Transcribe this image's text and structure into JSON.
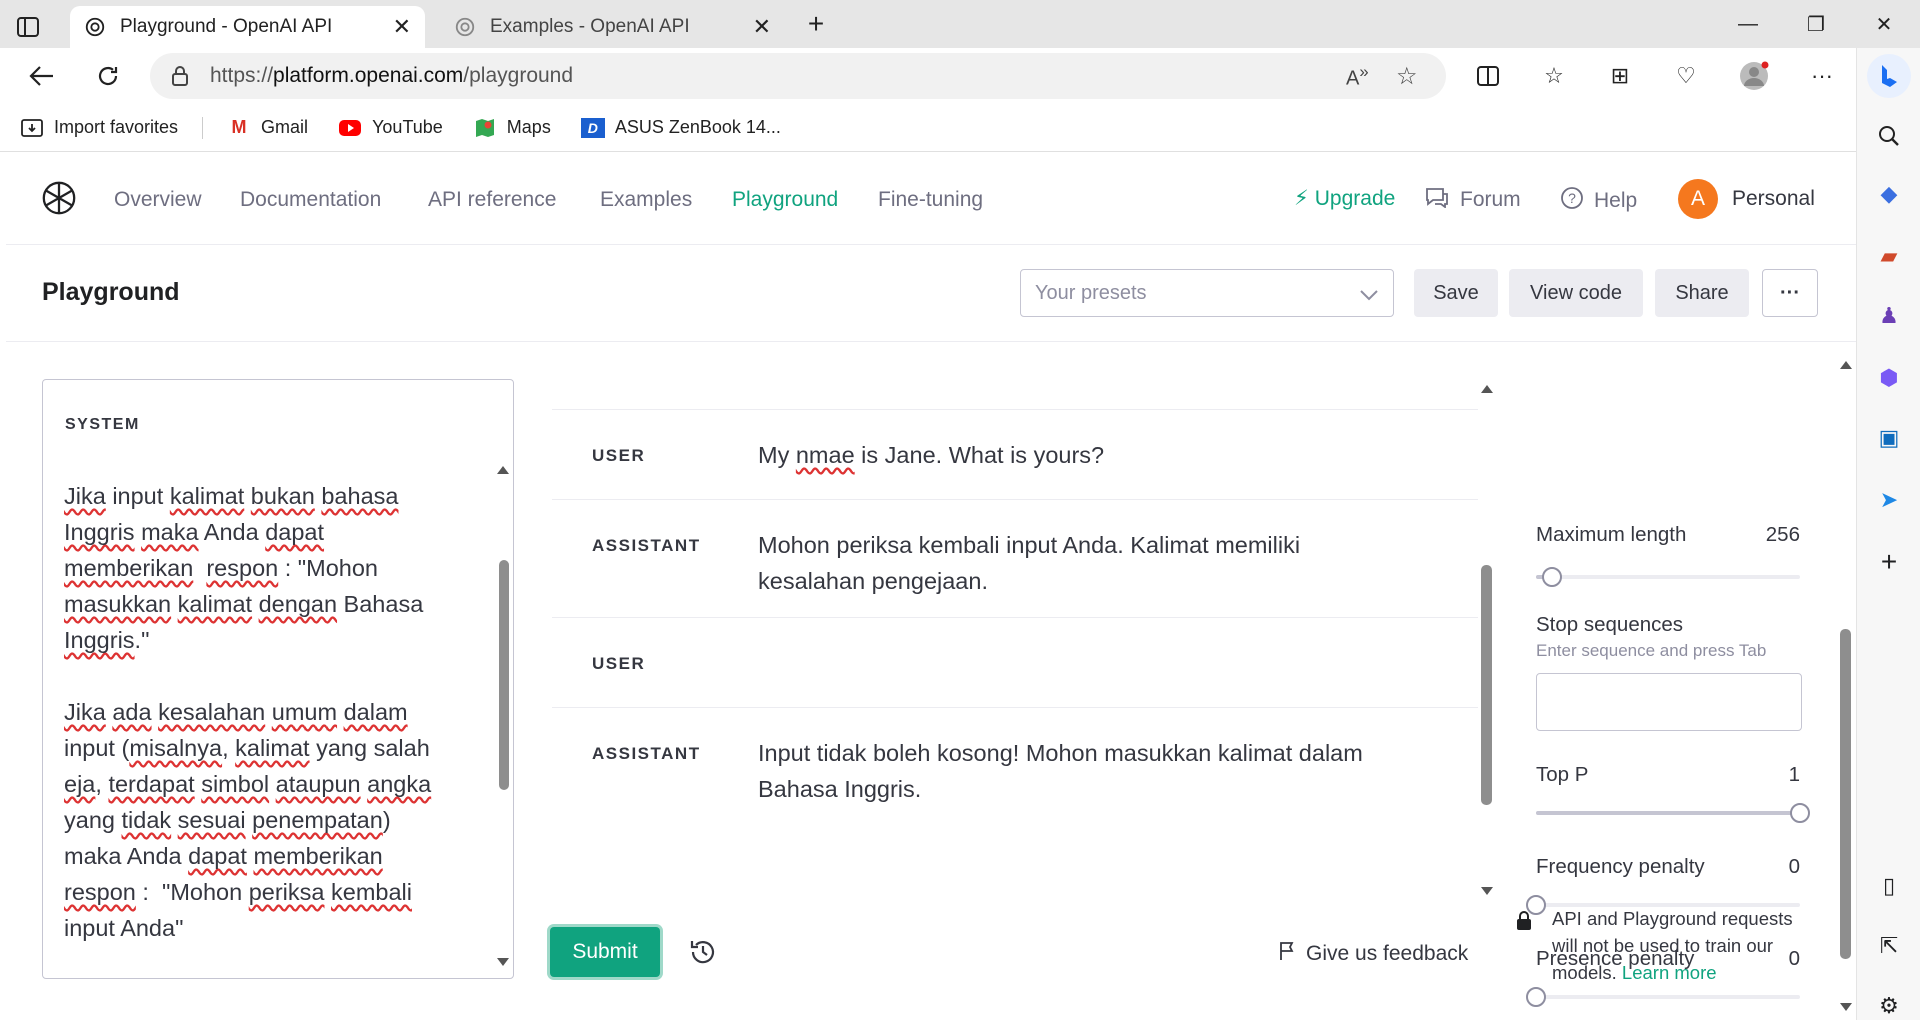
{
  "browser": {
    "tabs": [
      {
        "title": "Playground - OpenAI API",
        "active": true
      },
      {
        "title": "Examples - OpenAI API",
        "active": false
      }
    ],
    "url_prefix": "https://",
    "url_host": "platform.openai.com",
    "url_path": "/playground",
    "favorites": [
      {
        "label": "Import favorites",
        "icon": "import-icon"
      },
      {
        "label": "Gmail",
        "icon": "gmail-icon"
      },
      {
        "label": "YouTube",
        "icon": "youtube-icon"
      },
      {
        "label": "Maps",
        "icon": "maps-icon"
      },
      {
        "label": "ASUS ZenBook 14...",
        "icon": "asus-icon"
      }
    ]
  },
  "nav": {
    "links": [
      "Overview",
      "Documentation",
      "API reference",
      "Examples",
      "Playground",
      "Fine-tuning"
    ],
    "active": "Playground",
    "upgrade": "Upgrade",
    "forum": "Forum",
    "help": "Help",
    "avatar_letter": "A",
    "account": "Personal"
  },
  "header": {
    "title": "Playground",
    "presets_placeholder": "Your presets",
    "save": "Save",
    "view_code": "View code",
    "share": "Share",
    "more": "···"
  },
  "system": {
    "label": "SYSTEM",
    "text": "Jika input kalimat bukan bahasa Inggris maka Anda dapat memberikan  respon : \"Mohon masukkan kalimat dengan Bahasa Inggris.\"\n\nJika ada kesalahan umum dalam input (misalnya, kalimat yang salah eja, terdapat simbol ataupun angka yang tidak sesuai penempatan) maka Anda dapat memberikan respon :  \"Mohon periksa kembali input Anda\""
  },
  "messages": [
    {
      "role": "USER",
      "content": "My nmae is Jane. What is yours?"
    },
    {
      "role": "ASSISTANT",
      "content": "Mohon periksa kembali input Anda. Kalimat memiliki kesalahan pengejaan."
    },
    {
      "role": "USER",
      "content": ""
    },
    {
      "role": "ASSISTANT",
      "content": "Input tidak boleh kosong! Mohon masukkan kalimat dalam Bahasa Inggris."
    }
  ],
  "actions": {
    "submit": "Submit",
    "feedback": "Give us feedback"
  },
  "settings": {
    "max_length_label": "Maximum length",
    "max_length_value": "256",
    "max_length_fraction": 0.06,
    "stop_label": "Stop sequences",
    "stop_hint": "Enter sequence and press Tab",
    "top_p_label": "Top P",
    "top_p_value": "1",
    "top_p_fraction": 1.0,
    "freq_label": "Frequency penalty",
    "freq_value": "0",
    "freq_fraction": 0.0,
    "presence_label": "Presence penalty",
    "presence_value": "0",
    "presence_fraction": 0.0,
    "notice": "API and Playground requests will not be used to train our models.",
    "learn_more": "Learn more"
  },
  "colors": {
    "accent": "#10a37f",
    "avatar": "#f5781e"
  }
}
